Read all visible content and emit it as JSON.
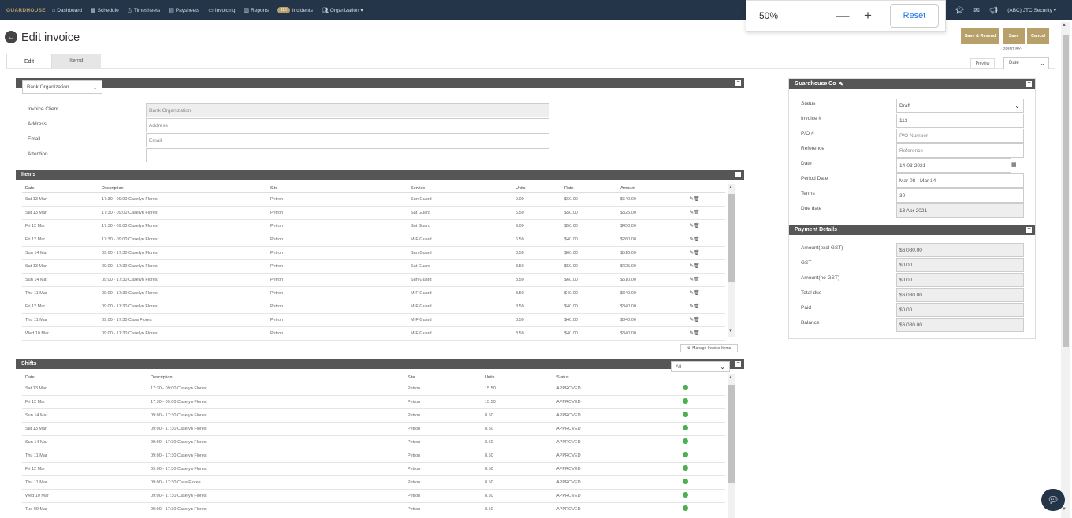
{
  "nav": {
    "brand": "GUARDHOUSE",
    "items": [
      {
        "label": "Dashboard",
        "icon": "⌂",
        "name": "dashboard"
      },
      {
        "label": "Schedule",
        "icon": "▦",
        "name": "schedule"
      },
      {
        "label": "Timesheets",
        "icon": "◷",
        "name": "timesheets"
      },
      {
        "label": "Paysheets",
        "icon": "▤",
        "name": "paysheets"
      },
      {
        "label": "Invoicing",
        "icon": "▭",
        "name": "invoicing"
      },
      {
        "label": "Reports",
        "icon": "▥",
        "name": "reports"
      }
    ],
    "incidents_badge": "116",
    "incidents_label": "Incidents",
    "organization_label": "Organization ▾",
    "org_name": "(ABC) JTC Security ▾"
  },
  "zoom": {
    "level": "50%",
    "minus": "—",
    "plus": "+",
    "reset": "Reset"
  },
  "page": {
    "title": "Edit invoice",
    "tabs": [
      "Edit",
      "Itemd"
    ],
    "buttons": {
      "save_resend": "Save & Resend",
      "save": "Save",
      "cancel": "Cancel"
    },
    "print_by_label": "PRINT BY:",
    "preview": "Preview",
    "print_by_value": "Date"
  },
  "client": {
    "org_select": "Bank Organization",
    "fields": [
      {
        "label": "Invoice Client",
        "value": "Bank Organization",
        "readonly": true
      },
      {
        "label": "Address",
        "value": "Address",
        "placeholder": true
      },
      {
        "label": "Email",
        "value": "Email",
        "placeholder": true
      },
      {
        "label": "Attention",
        "value": ""
      }
    ]
  },
  "items": {
    "title": "Items",
    "columns": [
      "Date",
      "Description",
      "Site",
      "Service",
      "Units",
      "Rate",
      "Amount"
    ],
    "rows": [
      [
        "Sat 13 Mar",
        "17:30 - 09:00 Caselyn Flores",
        "Petron",
        "Sun Guard",
        "9.00",
        "$60.00",
        "$540.00"
      ],
      [
        "Sat 13 Mar",
        "17:30 - 09:00 Caselyn Flores",
        "Petron",
        "Sat Guard",
        "6.50",
        "$50.00",
        "$325.00"
      ],
      [
        "Fri 12 Mar",
        "17:30 - 09:00 Caselyn Flores",
        "Petron",
        "Sat Guard",
        "9.00",
        "$50.00",
        "$450.00"
      ],
      [
        "Fri 12 Mar",
        "17:30 - 09:00 Caselyn Flores",
        "Petron",
        "M-F Guard",
        "6.50",
        "$40.00",
        "$260.00"
      ],
      [
        "Sun 14 Mar",
        "09:00 - 17:30 Caselyn Flores",
        "Petron",
        "Sun Guard",
        "8.50",
        "$60.00",
        "$510.00"
      ],
      [
        "Sat 13 Mar",
        "09:00 - 17:30 Caselyn Flores",
        "Petron",
        "Sat Guard",
        "8.50",
        "$50.00",
        "$425.00"
      ],
      [
        "Sun 14 Mar",
        "09:00 - 17:30 Caselyn Flores",
        "Petron",
        "Sun Guard",
        "8.50",
        "$60.00",
        "$510.00"
      ],
      [
        "Thu 11 Mar",
        "09:00 - 17:30 Caselyn Flores",
        "Petron",
        "M-F Guard",
        "8.50",
        "$40.00",
        "$340.00"
      ],
      [
        "Fri 12 Mar",
        "09:00 - 17:30 Caselyn Flores",
        "Petron",
        "M-F Guard",
        "8.50",
        "$40.00",
        "$340.00"
      ],
      [
        "Thu 11 Mar",
        "09:00 - 17:30 Casa Flores",
        "Petron",
        "M-F Guard",
        "8.50",
        "$40.00",
        "$340.00"
      ],
      [
        "Wed 10 Mar",
        "09:00 - 17:30 Caselyn Flores",
        "Petron",
        "M-F Guard",
        "8.50",
        "$40.00",
        "$340.00"
      ]
    ],
    "manage_button": "Manage Invoice Items"
  },
  "shifts": {
    "title": "Shifts",
    "filter": "All",
    "columns": [
      "Date",
      "Description",
      "Site",
      "Units",
      "Status"
    ],
    "rows": [
      [
        "Sat 13 Mar",
        "17:30 - 09:00 Caselyn Flores",
        "Petron",
        "15.50",
        "APPROVED"
      ],
      [
        "Fri 12 Mar",
        "17:30 - 09:00 Caselyn Flores",
        "Petron",
        "15.50",
        "APPROVED"
      ],
      [
        "Sun 14 Mar",
        "09:00 - 17:30 Caselyn Flores",
        "Petron",
        "8.50",
        "APPROVED"
      ],
      [
        "Sat 13 Mar",
        "09:00 - 17:30 Caselyn Flores",
        "Petron",
        "8.50",
        "APPROVED"
      ],
      [
        "Sun 14 Mar",
        "09:00 - 17:30 Caselyn Flores",
        "Petron",
        "8.50",
        "APPROVED"
      ],
      [
        "Thu 11 Mar",
        "09:00 - 17:30 Caselyn Flores",
        "Petron",
        "8.50",
        "APPROVED"
      ],
      [
        "Fri 12 Mar",
        "09:00 - 17:30 Caselyn Flores",
        "Petron",
        "8.50",
        "APPROVED"
      ],
      [
        "Thu 11 Mar",
        "09:00 - 17:30 Casa Flores",
        "Petron",
        "8.50",
        "APPROVED"
      ],
      [
        "Wed 10 Mar",
        "09:00 - 17:30 Caselyn Flores",
        "Petron",
        "8.50",
        "APPROVED"
      ],
      [
        "Tue 09 Mar",
        "09:00 - 17:30 Caselyn Flores",
        "Petron",
        "8.50",
        "APPROVED"
      ]
    ]
  },
  "company": {
    "title": "Guardhouse Co",
    "fields": [
      {
        "label": "Status",
        "value": "Draft",
        "type": "select"
      },
      {
        "label": "Invoice #",
        "value": "113",
        "type": "value"
      },
      {
        "label": "P/O #",
        "value": "P/O Number",
        "type": "placeholder"
      },
      {
        "label": "Reference",
        "value": "Reference",
        "type": "placeholder"
      },
      {
        "label": "Date",
        "value": "14-03-2021",
        "type": "date"
      },
      {
        "label": "Period Date",
        "value": "Mar 08 - Mar 14",
        "type": "value"
      },
      {
        "label": "Terms",
        "value": "30",
        "type": "value"
      },
      {
        "label": "Due date",
        "value": "13 Apr 2021",
        "type": "readonly"
      }
    ]
  },
  "payment": {
    "title": "Payment Details",
    "fields": [
      {
        "label": "Amount(excl GST)",
        "value": "$6,080.00"
      },
      {
        "label": "GST",
        "value": "$0.00"
      },
      {
        "label": "Amount(no GST)",
        "value": "$0.00"
      },
      {
        "label": "Total due",
        "value": "$6,080.00"
      },
      {
        "label": "Paid",
        "value": "$0.00"
      },
      {
        "label": "Balance",
        "value": "$6,080.00"
      }
    ]
  },
  "colors": {
    "navbar": "#253549",
    "accent": "#b8a06a",
    "panel_header": "#565656",
    "approved": "#4caf50"
  }
}
